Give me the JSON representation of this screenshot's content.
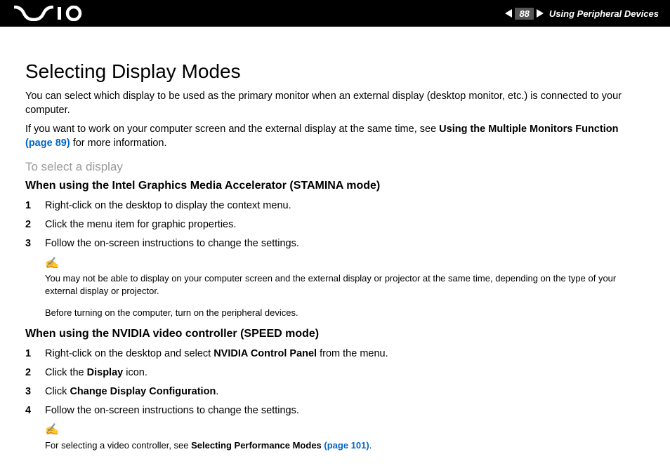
{
  "header": {
    "page_number": "88",
    "section": "Using Peripheral Devices"
  },
  "title": "Selecting Display Modes",
  "intro1": "You can select which display to be used as the primary monitor when an external display (desktop monitor, etc.) is connected to your computer.",
  "intro2_a": "If you want to work on your computer screen and the external display at the same time, see ",
  "intro2_bold": "Using the Multiple Monitors Function",
  "intro2_link": " (page 89)",
  "intro2_b": " for more information.",
  "sub_light": "To select a display",
  "section1_head": "When using the Intel Graphics Media Accelerator (STAMINA mode)",
  "s1_step1": "Right-click on the desktop to display the context menu.",
  "s1_step2": "Click the menu item for graphic properties.",
  "s1_step3": "Follow the on-screen instructions to change the settings.",
  "note1a": "You may not be able to display on your computer screen and the external display or projector at the same time, depending on the type of your external display or projector.",
  "note1b": "Before turning on the computer, turn on the peripheral devices.",
  "section2_head": "When using the NVIDIA video controller (SPEED mode)",
  "s2_step1_a": "Right-click on the desktop and select ",
  "s2_step1_bold": "NVIDIA Control Panel",
  "s2_step1_b": " from the menu.",
  "s2_step2_a": "Click the ",
  "s2_step2_bold": "Display",
  "s2_step2_b": " icon.",
  "s2_step3_a": "Click ",
  "s2_step3_bold": "Change Display Configuration",
  "s2_step3_b": ".",
  "s2_step4": "Follow the on-screen instructions to change the settings.",
  "note2_a": "For selecting a video controller, see ",
  "note2_bold": "Selecting Performance Modes",
  "note2_link": " (page 101)",
  "note2_b": ".",
  "nums": {
    "n1": "1",
    "n2": "2",
    "n3": "3",
    "n4": "4"
  },
  "note_icon": "✍"
}
